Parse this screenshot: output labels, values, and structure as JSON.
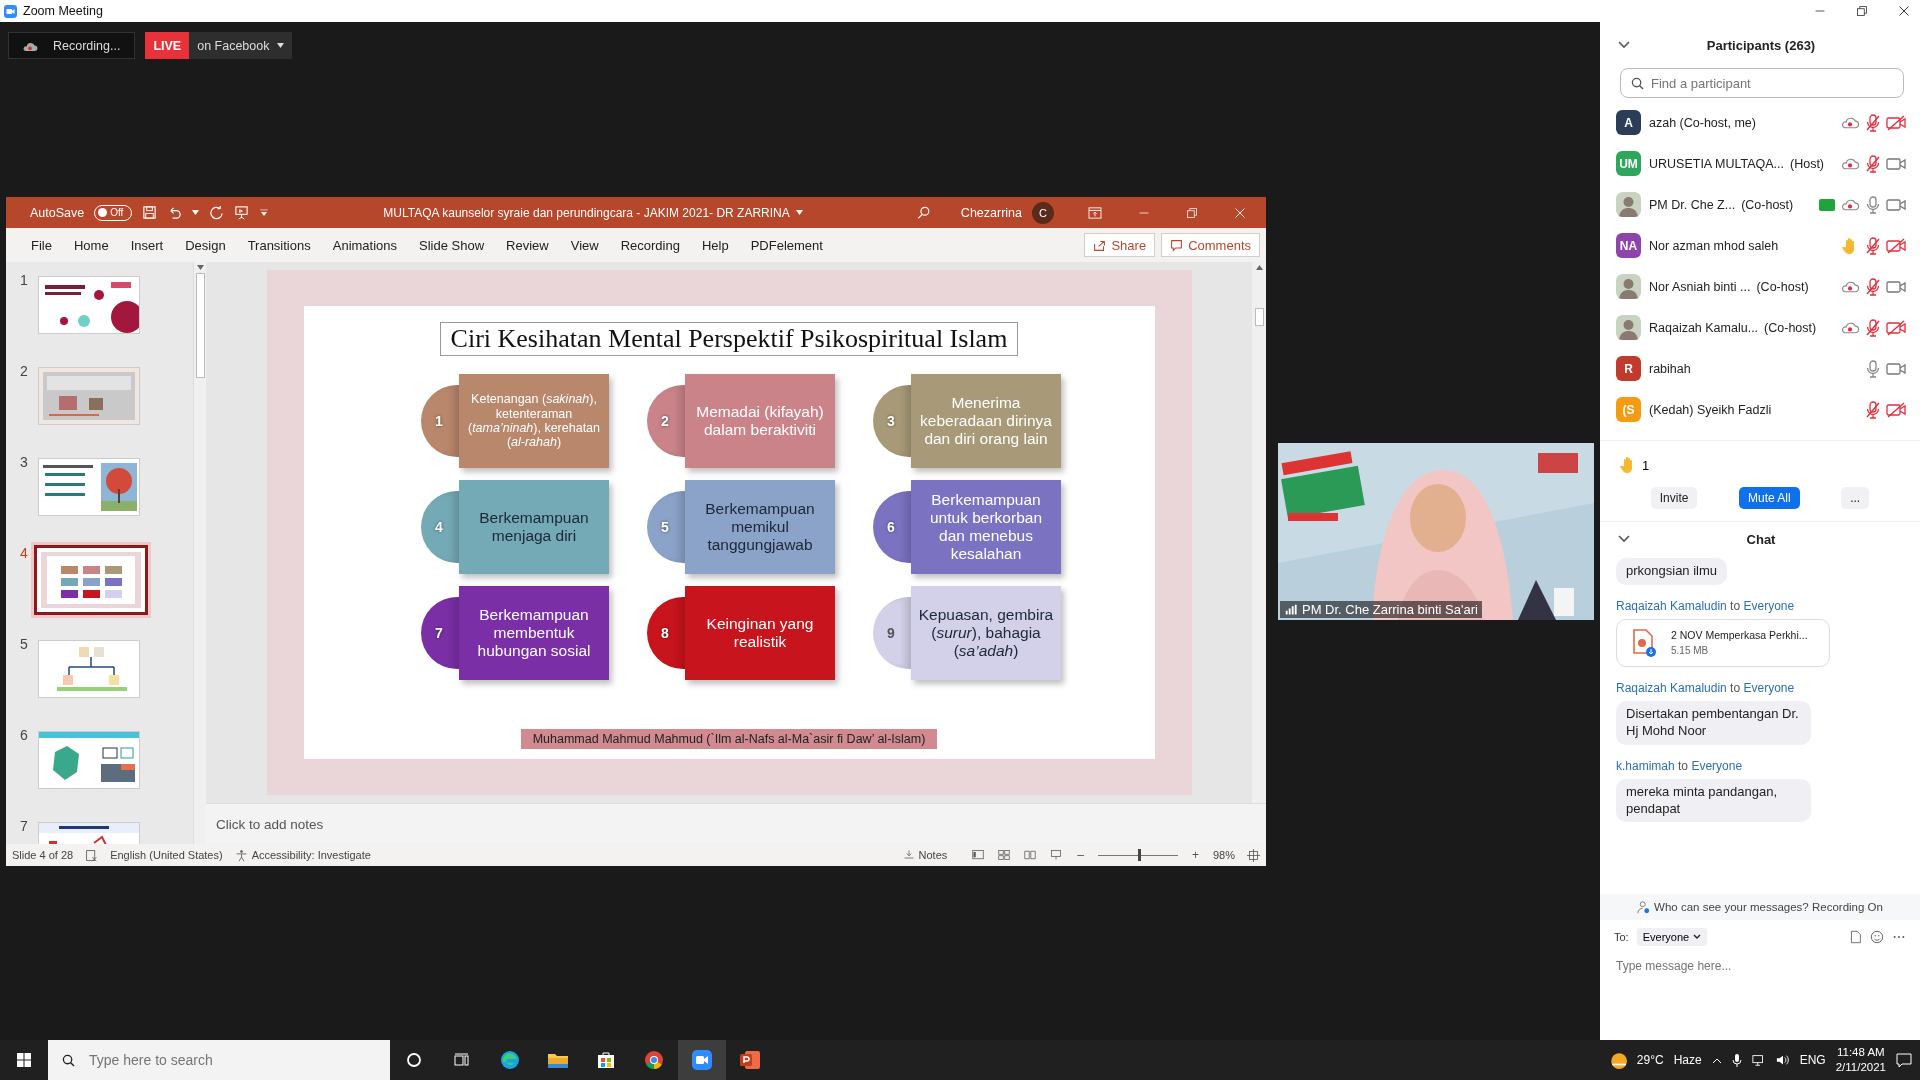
{
  "zoom_window": {
    "title": "Zoom Meeting"
  },
  "recording": {
    "label": "Recording...",
    "live_badge": "LIVE",
    "live_target": "on Facebook"
  },
  "powerpoint": {
    "autosave_label": "AutoSave",
    "autosave_state": "Off",
    "autosave_on": false,
    "title": "MULTAQA kaunselor syraie dan perundingcara - JAKIM 2021- DR ZARRINA",
    "user_name": "Chezarrina",
    "user_initial": "C",
    "ribbon_tabs": [
      "File",
      "Home",
      "Insert",
      "Design",
      "Transitions",
      "Animations",
      "Slide Show",
      "Review",
      "View",
      "Recording",
      "Help",
      "PDFelement"
    ],
    "share_button": "Share",
    "comments_button": "Comments",
    "slides": [
      {
        "number": "1",
        "selected": false
      },
      {
        "number": "2",
        "selected": false
      },
      {
        "number": "3",
        "selected": false
      },
      {
        "number": "4",
        "selected": true
      },
      {
        "number": "5",
        "selected": false
      },
      {
        "number": "6",
        "selected": false
      },
      {
        "number": "7",
        "selected": false
      }
    ],
    "slide": {
      "title": "Ciri Kesihatan Mental Perspektif Psikospiritual Islam",
      "items": [
        {
          "number": "1",
          "text": "Ketenangan (*sakinah*), ketenteraman (*tama’ninah*), kerehatan (*al-rahah*)",
          "color": "#b8876c",
          "dark_text": false
        },
        {
          "number": "2",
          "text": "Memadai (kifayah) dalam beraktiviti",
          "color": "#c98389",
          "dark_text": false
        },
        {
          "number": "3",
          "text": "Menerima keberadaan dirinya dan diri orang lain",
          "color": "#a89a78",
          "dark_text": false
        },
        {
          "number": "4",
          "text": "Berkemampuan menjaga diri",
          "color": "#74aab6",
          "dark_text": true
        },
        {
          "number": "5",
          "text": "Berkemampuan memikul tanggungjawab",
          "color": "#8ba2c9",
          "dark_text": true
        },
        {
          "number": "6",
          "text": "Berkemampuan untuk berkorban dan menebus kesalahan",
          "color": "#7b72c2",
          "dark_text": false
        },
        {
          "number": "7",
          "text": "Berkemampuan membentuk hubungan sosial",
          "color": "#7a2fa6",
          "dark_text": false
        },
        {
          "number": "8",
          "text": "Keinginan yang realistik",
          "color": "#c8141c",
          "dark_text": false
        },
        {
          "number": "9",
          "text": "Kepuasan, gembira (*surur*), bahagia (*sa’adah*)",
          "color": "#d3d1ea",
          "dark_text": true
        }
      ],
      "caption": "Muhammad Mahmud Mahmud (`Ilm al-Nafs al-Ma`asir fi Daw’ al-Islam)"
    },
    "notes_placeholder": "Click to add notes",
    "status_bar": {
      "slide_info": "Slide 4 of 28",
      "language": "English (United States)",
      "accessibility": "Accessibility: Investigate",
      "notes_button": "Notes",
      "zoom_out": "–",
      "zoom_in": "+",
      "zoom": "98%",
      "zoom_slider": {
        "level": 0.5
      }
    }
  },
  "video": {
    "name": "PM Dr. Che Zarrina binti Sa'ari"
  },
  "participants": {
    "title": "Participants (263)",
    "placeholder": "Find a participant",
    "people": [
      {
        "name": "azah (Co-host, me)",
        "avatar": {
          "kind": "initials",
          "text": "A",
          "color": "#2c3e57"
        },
        "recording": true,
        "raised_hand": false,
        "sharing": false,
        "muted": true,
        "video_off": true
      },
      {
        "name": "URUSETIA MULTAQA...",
        "role": "(Host)",
        "avatar": {
          "kind": "initials",
          "text": "UM",
          "color": "#2ea65c"
        },
        "recording": true,
        "raised_hand": false,
        "sharing": false,
        "muted": true,
        "video_off": false
      },
      {
        "name": "PM Dr. Che Z...",
        "role": "(Co-host)",
        "recording": true,
        "raised_hand": false,
        "sharing": true,
        "muted": false,
        "video_off": false
      },
      {
        "name": "Nor azman mhod saleh",
        "avatar": {
          "kind": "initials",
          "text": "NA",
          "color": "#8e44ad"
        },
        "recording": false,
        "raised_hand": true,
        "sharing": false,
        "muted": true,
        "video_off": true
      },
      {
        "name": "Nor Asniah binti ...",
        "role": "(Co-host)",
        "recording": true,
        "raised_hand": false,
        "sharing": false,
        "muted": true,
        "video_off": false
      },
      {
        "name": "Raqaizah Kamalu...",
        "role": "(Co-host)",
        "recording": true,
        "raised_hand": false,
        "sharing": false,
        "muted": true,
        "video_off": true
      },
      {
        "name": "rabihah",
        "avatar": {
          "kind": "initials",
          "text": "R",
          "color": "#c23a2b"
        },
        "recording": false,
        "raised_hand": false,
        "sharing": false,
        "muted": false,
        "video_off": false
      },
      {
        "name": "(Kedah) Syeikh Fadzli",
        "avatar": {
          "kind": "initials",
          "text": "(S",
          "color": "#f39c12"
        },
        "recording": false,
        "raised_hand": false,
        "sharing": false,
        "muted": true,
        "video_off": true
      }
    ],
    "raised_hands": "1",
    "buttons": [
      {
        "label": "Invite",
        "kind": "plain"
      },
      {
        "label": "Mute All",
        "kind": "primary"
      },
      {
        "label": "...",
        "kind": "plain"
      }
    ]
  },
  "chat": {
    "title": "Chat",
    "messages": [
      {
        "kind": "text",
        "text": "prkongsian ilmu"
      },
      {
        "kind": "file",
        "sender": "Raqaizah Kamaludin",
        "connector": "to",
        "recipient": "Everyone",
        "file_name": "2 NOV Memperkasa Perkhi...",
        "file_size": "5.15 MB"
      },
      {
        "kind": "text",
        "sender": "Raqaizah Kamaludin",
        "connector": "to",
        "recipient": "Everyone",
        "text": "Disertakan pembentangan Dr. Hj Mohd Noor"
      },
      {
        "kind": "text",
        "sender": "k.hamimah",
        "connector": "to",
        "recipient": "Everyone",
        "text": "mereka minta pandangan, pendapat"
      }
    ],
    "notice": "Who can see your messages? Recording On",
    "to_label": "To:",
    "recipient": "Everyone",
    "placeholder": "Type message here..."
  },
  "taskbar": {
    "placeholder": "Type here to search",
    "apps": [
      {
        "kind": "cortana",
        "active": false
      },
      {
        "kind": "taskview",
        "active": false
      },
      {
        "kind": "edge",
        "active": false
      },
      {
        "kind": "explorer",
        "active": false
      },
      {
        "kind": "store",
        "active": false
      },
      {
        "kind": "chrome",
        "active": false
      },
      {
        "kind": "zoom",
        "active": true
      },
      {
        "kind": "powerpoint",
        "active": false
      }
    ],
    "temperature": "29°C",
    "weather": "Haze",
    "language": "ENG",
    "time": "11:48 AM",
    "date": "2/11/2021"
  }
}
